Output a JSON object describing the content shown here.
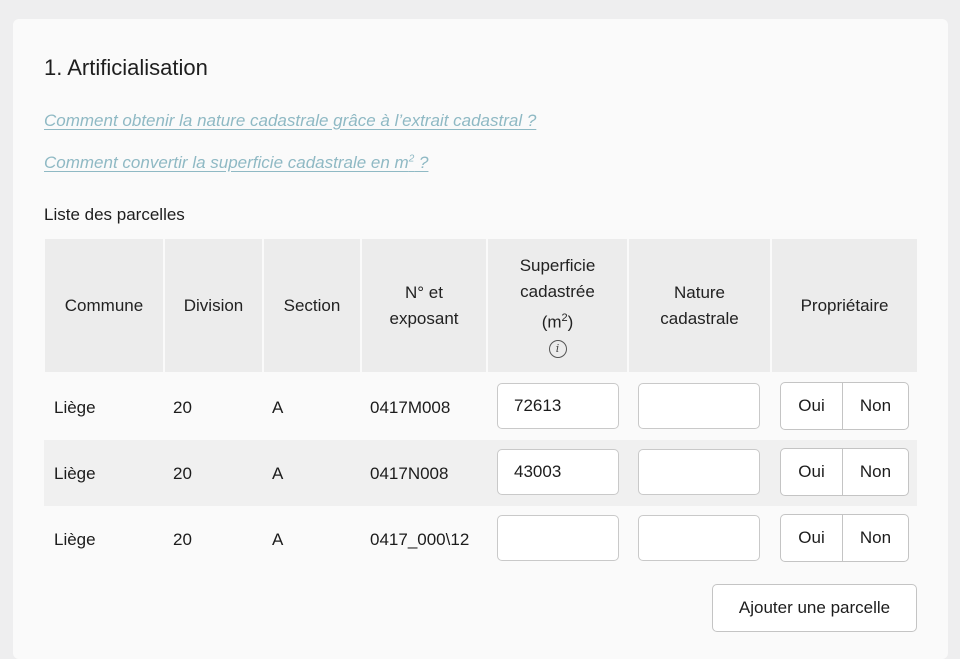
{
  "section": {
    "title": "1. Artificialisation",
    "help_link_1": "Comment obtenir la nature cadastrale grâce à l’extrait cadastral ?",
    "help_link_2_prefix": "Comment convertir la superficie cadastrale en m",
    "help_link_2_sup": "2",
    "help_link_2_suffix": " ?",
    "list_label": "Liste des parcelles"
  },
  "table": {
    "headers": {
      "commune": "Commune",
      "division": "Division",
      "section": "Section",
      "numero_line1": "N° et",
      "numero_line2": "exposant",
      "superficie_line1": "Superficie",
      "superficie_line2": "cadastrée",
      "superficie_line3_prefix": "(m",
      "superficie_line3_sup": "2",
      "superficie_line3_suffix": ")",
      "nature_line1": "Nature",
      "nature_line2": "cadastrale",
      "proprietaire": "Propriétaire"
    },
    "rows": [
      {
        "commune": "Liège",
        "division": "20",
        "section": "A",
        "numero": "0417M008",
        "superficie": "72613",
        "nature": "",
        "oui": "Oui",
        "non": "Non"
      },
      {
        "commune": "Liège",
        "division": "20",
        "section": "A",
        "numero": "0417N008",
        "superficie": "43003",
        "nature": "",
        "oui": "Oui",
        "non": "Non"
      },
      {
        "commune": "Liège",
        "division": "20",
        "section": "A",
        "numero": "0417_000\\12",
        "superficie": "",
        "nature": "",
        "oui": "Oui",
        "non": "Non"
      }
    ]
  },
  "actions": {
    "add_parcel": "Ajouter une parcelle"
  },
  "icons": {
    "info": "info-icon"
  }
}
